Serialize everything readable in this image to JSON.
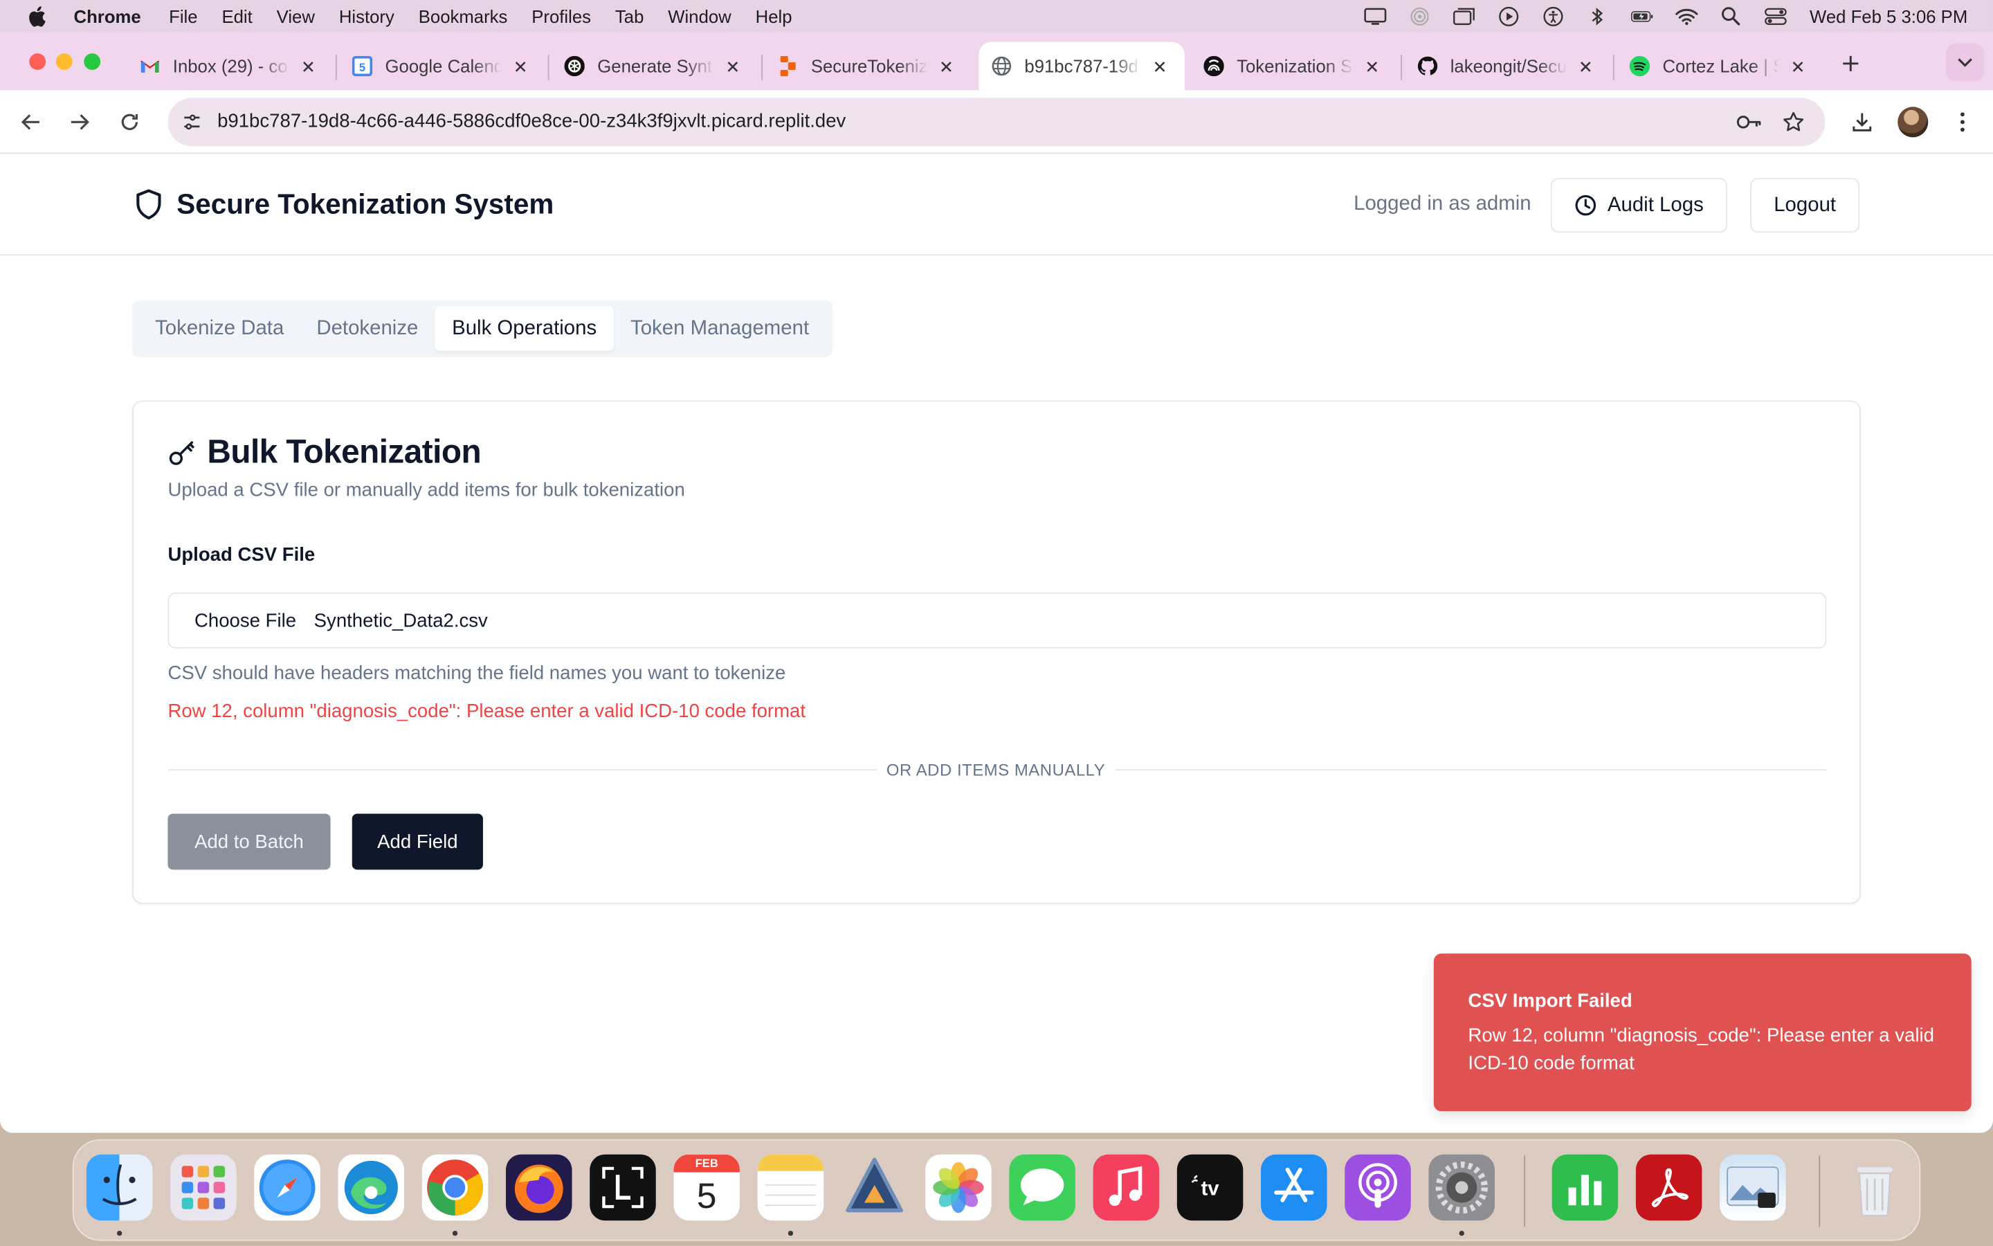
{
  "menubar": {
    "app": "Chrome",
    "items": [
      "File",
      "Edit",
      "View",
      "History",
      "Bookmarks",
      "Profiles",
      "Tab",
      "Window",
      "Help"
    ],
    "clock": "Wed Feb 5  3:06 PM",
    "status_icons": [
      "display-icon",
      "airdrop-icon",
      "window-icon",
      "play-icon",
      "accessibility-icon",
      "bluetooth-icon",
      "battery-icon",
      "wifi-icon",
      "spotlight-icon",
      "control-center-icon"
    ]
  },
  "browser": {
    "tabs": [
      {
        "title": "Inbox (29) - co",
        "favicon": "gmail-icon"
      },
      {
        "title": "Google Calend",
        "favicon": "calendar-icon"
      },
      {
        "title": "Generate Synt",
        "favicon": "openai-icon"
      },
      {
        "title": "SecureTokeniz",
        "favicon": "replit-icon"
      },
      {
        "title": "b91bc787-19d",
        "favicon": "globe-icon",
        "active": true
      },
      {
        "title": "Tokenization S",
        "favicon": "perplexity-icon"
      },
      {
        "title": "lakeongit/Secu",
        "favicon": "github-icon"
      },
      {
        "title": "Cortez Lake | S",
        "favicon": "spotify-icon"
      }
    ],
    "url": "b91bc787-19d8-4c66-a446-5886cdf0e8ce-00-z34k3f9jxvlt.picard.replit.dev"
  },
  "app": {
    "title": "Secure Tokenization System",
    "logged_in": "Logged in as admin",
    "audit_label": "Audit Logs",
    "logout_label": "Logout",
    "tabs": [
      "Tokenize Data",
      "Detokenize",
      "Bulk Operations",
      "Token Management"
    ],
    "active_tab": "Bulk Operations"
  },
  "card": {
    "title": "Bulk Tokenization",
    "description": "Upload a CSV file or manually add items for bulk tokenization",
    "upload_label": "Upload CSV File",
    "choose_file": "Choose File",
    "file_name": "Synthetic_Data2.csv",
    "helper": "CSV should have headers matching the field names you want to tokenize",
    "error": "Row 12, column \"diagnosis_code\": Please enter a valid ICD-10 code format",
    "divider": "OR ADD ITEMS MANUALLY",
    "add_to_batch": "Add to Batch",
    "add_field": "Add Field"
  },
  "toast": {
    "title": "CSV Import Failed",
    "message": "Row 12, column \"diagnosis_code\": Please enter a valid ICD-10 code format"
  },
  "dock": {
    "calendar_month": "FEB",
    "calendar_day": "5",
    "apps": [
      "finder-icon",
      "launchpad-icon",
      "safari-icon",
      "edge-icon",
      "chrome-icon",
      "firefox-icon",
      "screenshot-app-icon",
      "calendar-icon",
      "notes-icon",
      "vpn-app-icon",
      "photos-icon",
      "messages-icon",
      "music-icon",
      "apple-tv-icon",
      "app-store-icon",
      "podcasts-icon",
      "system-settings-icon",
      "numbers-icon",
      "acrobat-icon",
      "preview-icon",
      "trash-icon"
    ]
  },
  "colors": {
    "error": "#ef4444",
    "toast": "#e05252",
    "primary": "#0f172a",
    "disabled_button": "#8a919b"
  }
}
